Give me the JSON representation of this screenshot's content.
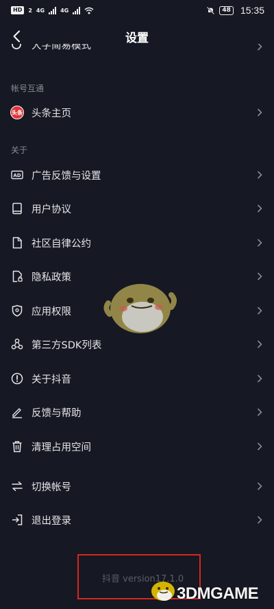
{
  "status_bar": {
    "left_badge": "HD",
    "left_badge2": "2",
    "network1": "4G",
    "network2": "4G",
    "battery": "48",
    "time": "15:35"
  },
  "nav": {
    "title": "设置"
  },
  "partial_row": {
    "label": "大字简易模式"
  },
  "sections": [
    {
      "label": "帐号互通",
      "items": [
        {
          "label": "头条主页",
          "icon": "toutiao-logo",
          "icon_text": "头条"
        }
      ]
    },
    {
      "label": "关于",
      "items": [
        {
          "label": "广告反馈与设置",
          "icon": "ad-icon"
        },
        {
          "label": "用户协议",
          "icon": "book-icon"
        },
        {
          "label": "社区自律公约",
          "icon": "document-icon"
        },
        {
          "label": "隐私政策",
          "icon": "privacy-document-icon"
        },
        {
          "label": "应用权限",
          "icon": "shield-icon"
        },
        {
          "label": "第三方SDK列表",
          "icon": "nodes-icon"
        },
        {
          "label": "关于抖音",
          "icon": "info-icon"
        },
        {
          "label": "反馈与帮助",
          "icon": "pencil-icon"
        },
        {
          "label": "清理占用空间",
          "icon": "trash-icon"
        }
      ]
    }
  ],
  "account_actions": [
    {
      "label": "切换帐号",
      "icon": "switch-icon"
    },
    {
      "label": "退出登录",
      "icon": "logout-icon"
    }
  ],
  "version": "抖音 version17.1.0",
  "watermark": "3DMGAME",
  "colors": {
    "background": "#161823",
    "highlight_box": "#d9261c",
    "toutiao_red": "#e0353b"
  }
}
